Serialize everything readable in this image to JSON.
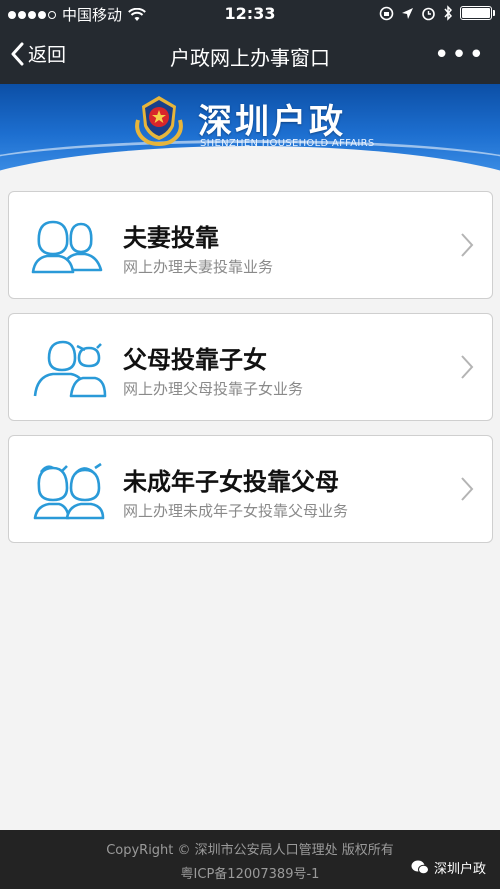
{
  "status_bar": {
    "carrier": "中国移动",
    "time": "12:33",
    "battery_level": 1.0
  },
  "nav": {
    "back_label": "返回",
    "title": "户政网上办事窗口",
    "more_label": "•••"
  },
  "banner": {
    "title": "深圳户政",
    "subtitle": "SHENZHEN HOUSEHOLD AFFAIRS"
  },
  "services": [
    {
      "title": "夫妻投靠",
      "subtitle": "网上办理夫妻投靠业务",
      "icon": "couple-icon"
    },
    {
      "title": "父母投靠子女",
      "subtitle": "网上办理父母投靠子女业务",
      "icon": "parent-child-icon"
    },
    {
      "title": "未成年子女投靠父母",
      "subtitle": "网上办理未成年子女投靠父母业务",
      "icon": "children-icon"
    }
  ],
  "footer": {
    "line1": "CopyRight © 深圳市公安局人口管理处 版权所有",
    "line2": "粤ICP备12007389号-1",
    "watermark": "深圳户政"
  },
  "colors": {
    "nav_bg": "#252a30",
    "banner_blue": "#1d6fd0",
    "icon_blue": "#2a9ad8",
    "footer_bg": "#232323"
  }
}
